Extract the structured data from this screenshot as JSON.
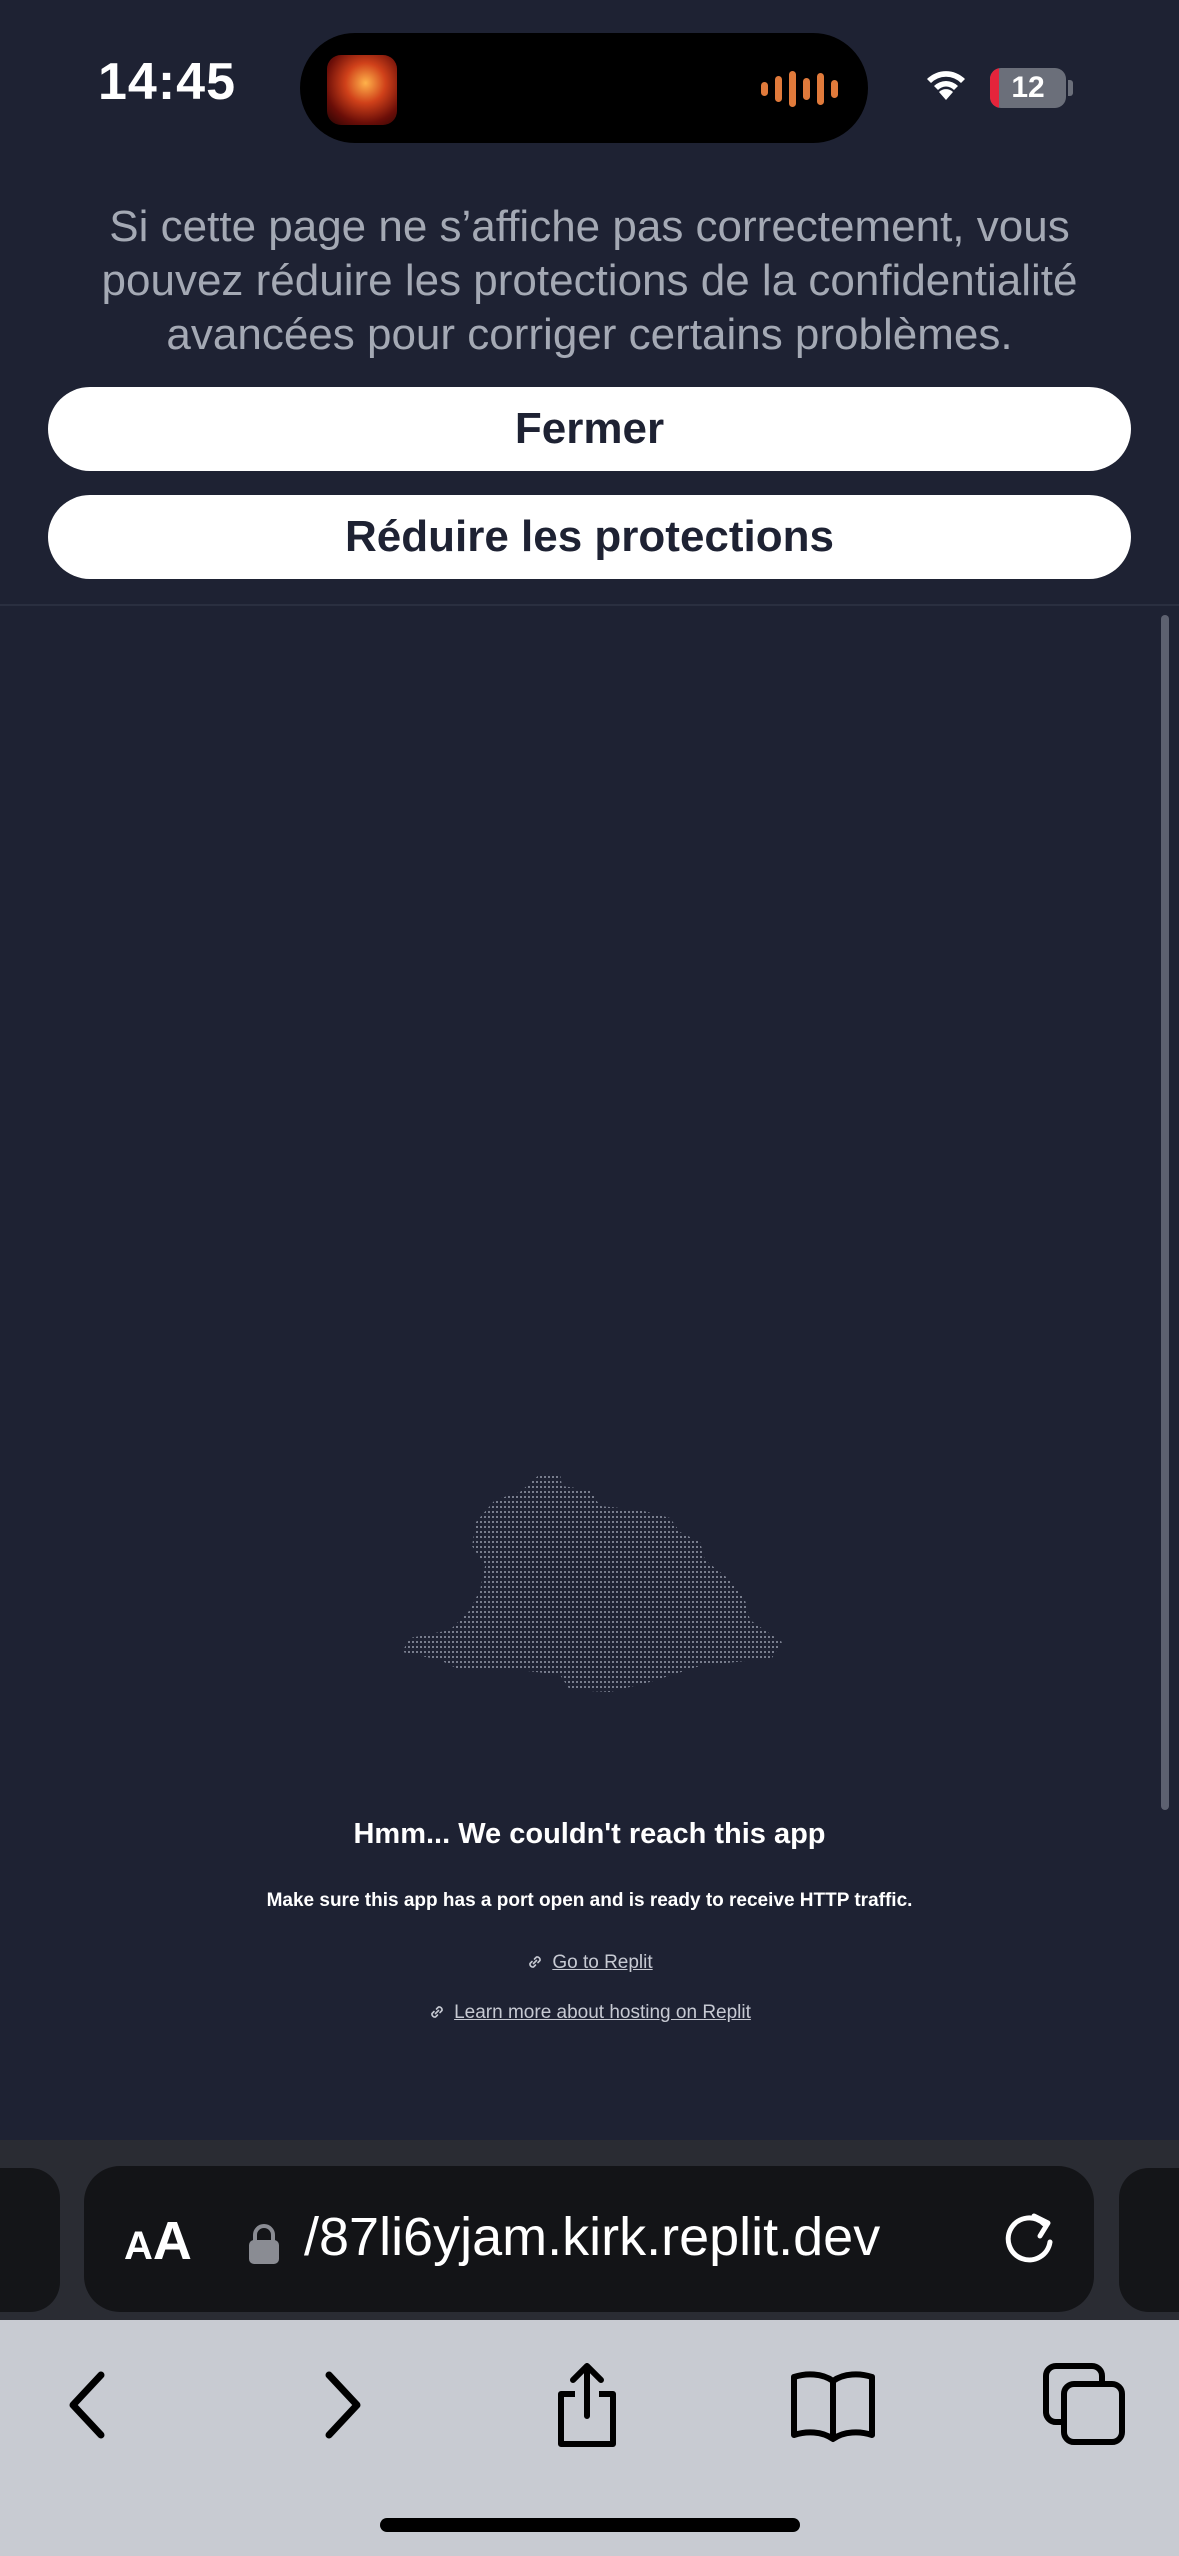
{
  "status_bar": {
    "time": "14:45",
    "battery_level": "12",
    "battery_fraction": 0.12,
    "battery_charging": true,
    "icons": [
      "album-art-icon",
      "audio-waveform-icon",
      "wifi-icon",
      "battery-icon"
    ]
  },
  "privacy_banner": {
    "message": "Si cette page ne s’affiche pas correctement, vous pouvez réduire les protections de la confidentialité avancées pour corriger certains problèmes.",
    "close_label": "Fermer",
    "reduce_label": "Réduire les protections"
  },
  "page": {
    "error_title": "Hmm... We couldn't reach this app",
    "error_subtitle": "Make sure this app has a port open and is ready to receive HTTP traffic.",
    "link_replit": "Go to Replit",
    "link_hosting": "Learn more about hosting on Replit"
  },
  "address_bar": {
    "reader_label_small": "A",
    "reader_label_big": "A",
    "url": "/87li6yjam.kirk.replit.dev"
  },
  "toolbar": {
    "buttons": [
      "back-icon",
      "forward-icon",
      "share-icon",
      "bookmarks-icon",
      "tabs-icon"
    ]
  },
  "colors": {
    "page_background": "#1e2233",
    "banner_text": "#a4a9b4",
    "toolbar_background": "#c8cbd2",
    "battery_red": "#e5243b",
    "waveform": "#e07a3b"
  }
}
